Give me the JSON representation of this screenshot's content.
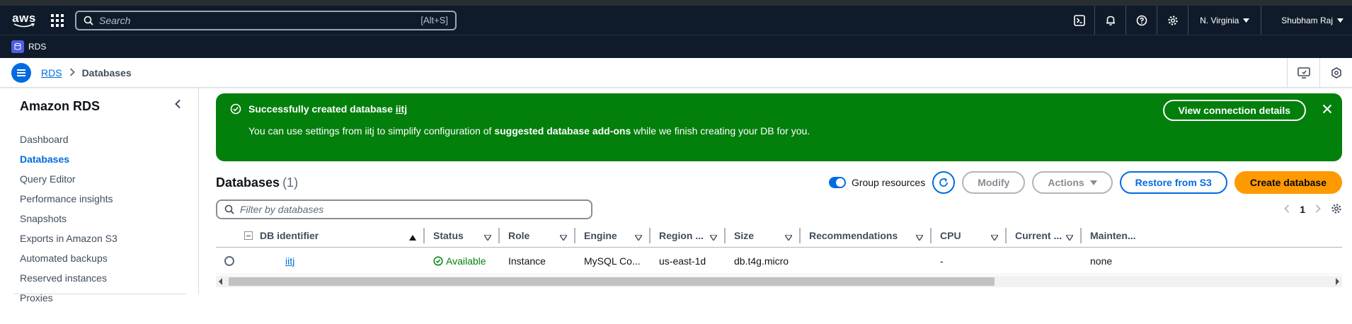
{
  "topnav": {
    "logo": "aws",
    "search_placeholder": "Search",
    "search_shortcut": "[Alt+S]",
    "region": "N. Virginia",
    "user": "Shubham Raj"
  },
  "service": {
    "name": "RDS"
  },
  "breadcrumb": {
    "root": "RDS",
    "current": "Databases"
  },
  "sidebar": {
    "title": "Amazon RDS",
    "items": [
      {
        "label": "Dashboard"
      },
      {
        "label": "Databases"
      },
      {
        "label": "Query Editor"
      },
      {
        "label": "Performance insights"
      },
      {
        "label": "Snapshots"
      },
      {
        "label": "Exports in Amazon S3"
      },
      {
        "label": "Automated backups"
      },
      {
        "label": "Reserved instances"
      },
      {
        "label": "Proxies"
      }
    ]
  },
  "flash": {
    "title_prefix": "Successfully created database",
    "db_name": "iitj",
    "body_start": "You can use settings from iitj to simplify configuration of",
    "body_bold": "suggested database add-ons",
    "body_end": "while we finish creating your DB for you.",
    "button": "View connection details"
  },
  "databases": {
    "title": "Databases",
    "count": "(1)",
    "group_label": "Group resources",
    "modify": "Modify",
    "actions": "Actions",
    "restore": "Restore from S3",
    "create": "Create database",
    "filter_placeholder": "Filter by databases",
    "page": "1",
    "columns": [
      "DB identifier",
      "Status",
      "Role",
      "Engine",
      "Region ...",
      "Size",
      "Recommendations",
      "CPU",
      "Current ...",
      "Mainten..."
    ],
    "rows": [
      {
        "id": "iitj",
        "status": "Available",
        "role": "Instance",
        "engine": "MySQL Co...",
        "region": "us-east-1d",
        "size": "db.t4g.micro",
        "recommendations": "",
        "cpu": "-",
        "current": "",
        "maintenance": "none"
      }
    ]
  },
  "colors": {
    "success": "#037f0c",
    "primary": "#006ce0",
    "accent": "#ff9900",
    "header_bg": "#0f1b2a"
  }
}
